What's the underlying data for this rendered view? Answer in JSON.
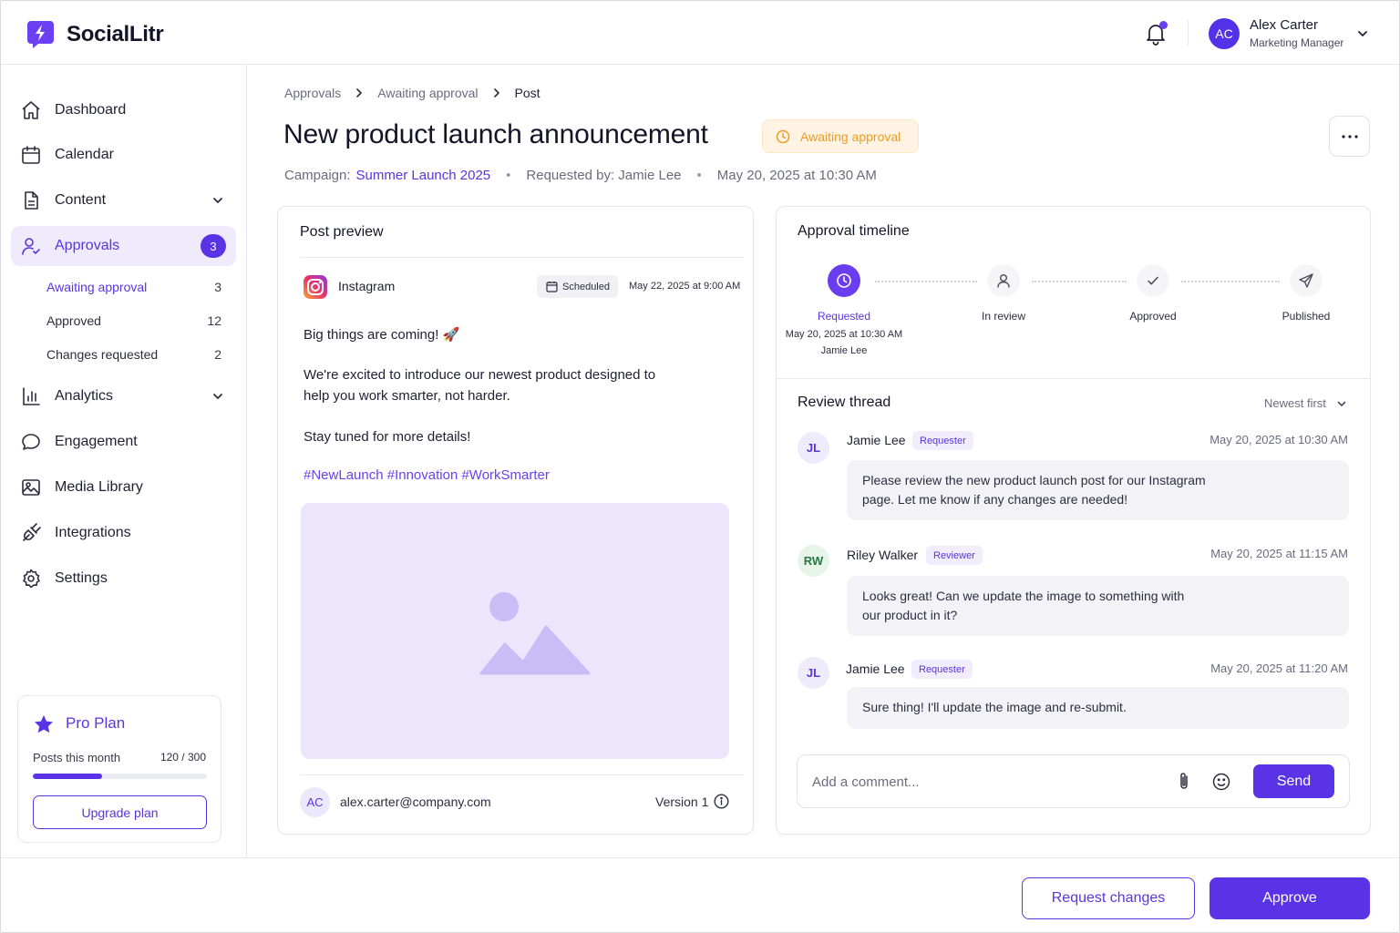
{
  "app": {
    "name": "SocialLitr"
  },
  "colors": {
    "accent": "#5b33e6",
    "warning": "#f09b22",
    "success": "#2b7a44"
  },
  "user": {
    "initials": "AC",
    "name": "Alex Carter",
    "role": "Marketing Manager"
  },
  "sidebar": {
    "items": [
      {
        "label": "Dashboard",
        "icon": "home-icon"
      },
      {
        "label": "Calendar",
        "icon": "calendar-icon"
      },
      {
        "label": "Content",
        "icon": "document-icon"
      },
      {
        "label": "Approvals",
        "icon": "user-check-icon",
        "badge": "3"
      },
      {
        "label": "Analytics",
        "icon": "bar-chart-icon"
      },
      {
        "label": "Engagement",
        "icon": "chat-bubble-icon"
      },
      {
        "label": "Media Library",
        "icon": "image-icon"
      },
      {
        "label": "Integrations",
        "icon": "plug-icon"
      },
      {
        "label": "Settings",
        "icon": "gear-icon"
      }
    ],
    "approvals_sub": [
      {
        "label": "Awaiting approval",
        "count": "3"
      },
      {
        "label": "Approved",
        "count": "12"
      },
      {
        "label": "Changes requested",
        "count": "2"
      }
    ],
    "plan": {
      "title": "Pro Plan",
      "posts_label": "Posts this month",
      "posts_value": "120 / 300",
      "progress": 0.4,
      "upgrade_label": "Upgrade plan"
    }
  },
  "breadcrumb": [
    "Approvals",
    "Awaiting approval",
    "Post"
  ],
  "page": {
    "title": "New product launch announcement",
    "status": "Awaiting approval",
    "campaign_label": "Campaign:",
    "campaign": "Summer Launch 2025",
    "requested_by": "Requested by: Jamie Lee",
    "requested_at": "May 20, 2025 at 10:30 AM"
  },
  "preview": {
    "title": "Post preview",
    "platform": "Instagram",
    "scheduled_label": "Scheduled",
    "scheduled_at": "May 22, 2025 at 9:00 AM",
    "paragraph1": "Big things are coming! 🚀",
    "paragraph2_line1": "We're excited to introduce our newest product designed to",
    "paragraph2_line2": "help you work smarter, not harder.",
    "paragraph3": "Stay tuned for more details!",
    "hashtags": "#NewLaunch #Innovation #WorkSmarter",
    "author_initials": "AC",
    "author_email": "alex.carter@company.com",
    "version": "Version 1"
  },
  "timeline": {
    "title": "Approval timeline",
    "steps": [
      {
        "label": "Requested",
        "date": "May 20, 2025 at 10:30 AM",
        "by": "Jamie Lee",
        "icon": "clock-icon"
      },
      {
        "label": "In review",
        "icon": "user-icon"
      },
      {
        "label": "Approved",
        "icon": "check-icon"
      },
      {
        "label": "Published",
        "icon": "send-icon"
      }
    ]
  },
  "thread": {
    "title": "Review thread",
    "sort": "Newest first",
    "comments": [
      {
        "initials": "JL",
        "name": "Jamie Lee",
        "role": "Requester",
        "time": "May 20, 2025 at 10:30 AM",
        "line1": "Please review the new product launch post for our Instagram",
        "line2": "page. Let me know if any changes are needed!"
      },
      {
        "initials": "RW",
        "name": "Riley Walker",
        "role": "Reviewer",
        "time": "May 20, 2025 at 11:15 AM",
        "line1": "Looks great! Can we update the image to something with",
        "line2": "our product in it?"
      },
      {
        "initials": "JL",
        "name": "Jamie Lee",
        "role": "Requester",
        "time": "May 20, 2025 at 11:20 AM",
        "line1": "Sure thing! I'll update the image and re-submit."
      }
    ],
    "comment_placeholder": "Add a comment...",
    "send_label": "Send"
  },
  "footer": {
    "request_changes": "Request changes",
    "approve": "Approve"
  }
}
